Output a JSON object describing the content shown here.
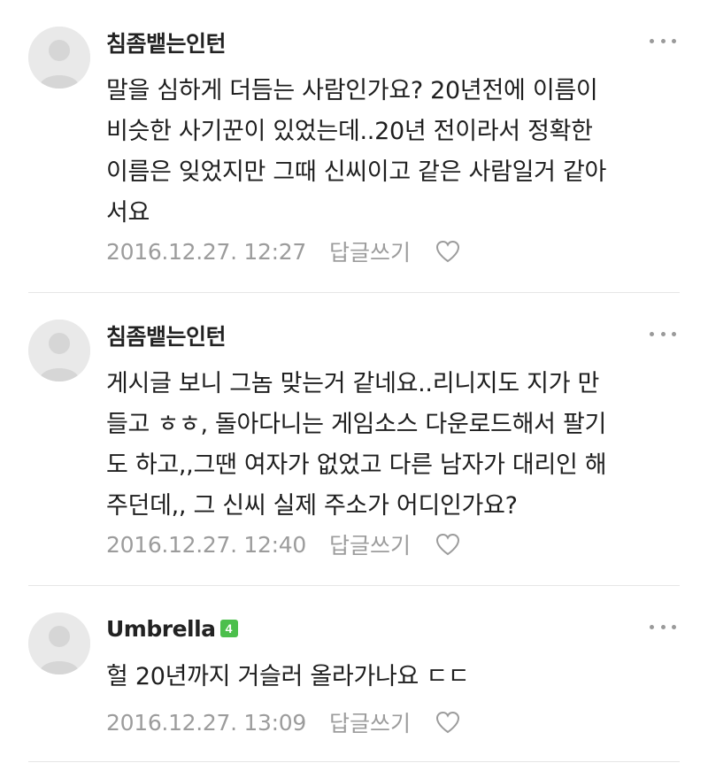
{
  "comments": [
    {
      "author": "침좀뱉는인턴",
      "level": "",
      "text": "말을 심하게 더듬는 사람인가요? 20년전에 이름이\n비슷한 사기꾼이 있었는데..20년 전이라서 정확한\n이름은 잊었지만 그때 신씨이고 같은 사람일거 같아\n서요",
      "date": "2016.12.27. 12:27",
      "reply_label": "답글쓰기"
    },
    {
      "author": "침좀뱉는인턴",
      "level": "",
      "text": "게시글 보니 그놈 맞는거 같네요..리니지도 지가 만\n들고 ㅎㅎ, 돌아다니는 게임소스 다운로드해서 팔기\n도 하고,,그땐 여자가 없었고 다른 남자가 대리인 해\n주던데,, 그 신씨 실제 주소가 어디인가요?",
      "date": "2016.12.27. 12:40",
      "reply_label": "답글쓰기"
    },
    {
      "author": "Umbrella",
      "level": "4",
      "text": "헐 20년까지 거슬러 올라가나요 ㄷㄷ",
      "date": "2016.12.27. 13:09",
      "reply_label": "답글쓰기"
    }
  ],
  "icons": {
    "avatar": "default-user-avatar-icon",
    "more": "more-dots-icon",
    "like": "heart-outline-icon"
  },
  "colors": {
    "level_badge": "#4cbf4c",
    "meta_text": "#9c9c9c",
    "divider": "#e6e6e6"
  }
}
